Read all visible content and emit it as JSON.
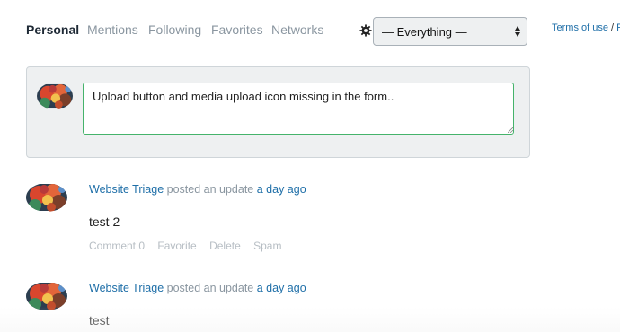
{
  "tabs": [
    "Personal",
    "Mentions",
    "Following",
    "Favorites",
    "Networks"
  ],
  "filter": {
    "icon": "gear-icon",
    "selected": "— Everything —"
  },
  "footer_links": {
    "terms": "Terms of use",
    "separator": "/",
    "privacy": "Pr"
  },
  "post_form": {
    "text": "Upload button and media upload icon missing in the form.."
  },
  "activities": [
    {
      "author": "Website Triage",
      "action": "posted an update",
      "time": "a day ago",
      "content": "test 2",
      "actions": {
        "comment": "Comment 0",
        "favorite": "Favorite",
        "delete": "Delete",
        "spam": "Spam"
      }
    },
    {
      "author": "Website Triage",
      "action": "posted an update",
      "time": "a day ago",
      "content": "test"
    }
  ],
  "colors": {
    "link": "#1f6fa8",
    "muted": "#8a96a0",
    "focus_border": "#45b36b",
    "panel_bg": "#eef0f1"
  }
}
